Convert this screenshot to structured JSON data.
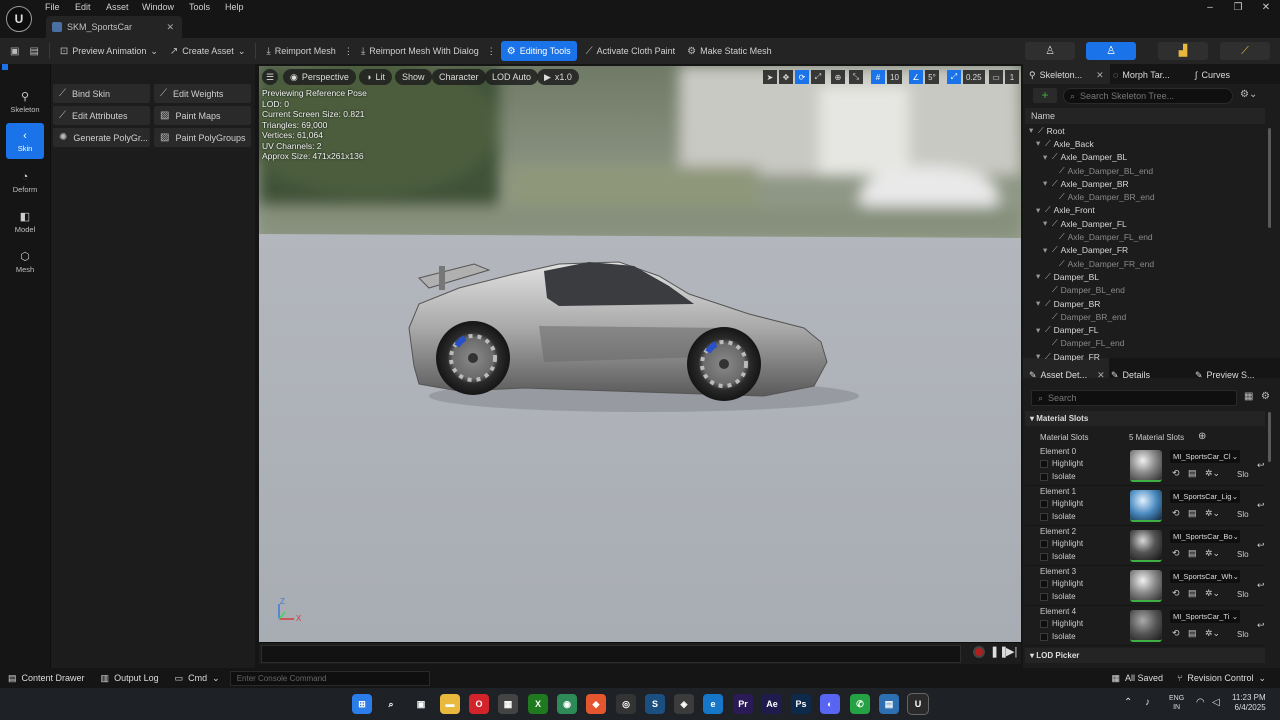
{
  "app": {
    "logo": "U",
    "menus": [
      "File",
      "Edit",
      "Asset",
      "Window",
      "Tools",
      "Help"
    ],
    "doc_tab": "SKM_SportsCar"
  },
  "window_controls": {
    "minimize": "–",
    "maximize": "❐",
    "close": "✕"
  },
  "toolbar": {
    "preview_animation": "Preview Animation",
    "create_asset": "Create Asset",
    "reimport_mesh": "Reimport Mesh",
    "reimport_with_dialog": "Reimport Mesh With Dialog",
    "editing_tools": "Editing Tools",
    "activate_cloth": "Activate Cloth Paint",
    "make_static": "Make Static Mesh"
  },
  "modes": [
    {
      "label": "Skeleton",
      "icon": "skeleton-icon"
    },
    {
      "label": "Skin",
      "icon": "skin-icon"
    },
    {
      "label": "Deform",
      "icon": "deform-icon"
    },
    {
      "label": "Model",
      "icon": "model-icon"
    },
    {
      "label": "Mesh",
      "icon": "mesh-icon"
    }
  ],
  "tools": [
    {
      "label": "Bind Skin",
      "icon": "bind-skin-icon"
    },
    {
      "label": "Edit Weights",
      "icon": "edit-weights-icon"
    },
    {
      "label": "Edit Attributes",
      "icon": "edit-attributes-icon"
    },
    {
      "label": "Paint Maps",
      "icon": "paint-maps-icon"
    },
    {
      "label": "Generate PolyGr...",
      "icon": "generate-polygroups-icon"
    },
    {
      "label": "Paint PolyGroups",
      "icon": "paint-polygroups-icon"
    }
  ],
  "viewport": {
    "perspective": "Perspective",
    "lit": "Lit",
    "show": "Show",
    "character": "Character",
    "lod": "LOD Auto",
    "speed": "x1.0",
    "grid_snap": "10",
    "angle_snap": "5°",
    "scale_snap": "0.25",
    "camera_speed": "1",
    "stats": [
      "Previewing Reference Pose",
      "LOD: 0",
      "Current Screen Size: 0.821",
      "Triangles: 69,000",
      "Vertices: 61,064",
      "UV Channels: 2",
      "Approx Size: 471x261x136"
    ],
    "axis_z": "Z",
    "axis_x": "X"
  },
  "skeleton_panel": {
    "tab_skeleton": "Skeleton...",
    "tab_morph": "Morph Tar...",
    "tab_curves": "Curves",
    "search_placeholder": "Search Skeleton Tree...",
    "column_name": "Name",
    "bones": [
      {
        "name": "Root",
        "dim": false
      },
      {
        "name": "Axle_Back",
        "dim": false
      },
      {
        "name": "Axle_Damper_BL",
        "dim": false
      },
      {
        "name": "Axle_Damper_BL_end",
        "dim": true
      },
      {
        "name": "Axle_Damper_BR",
        "dim": false
      },
      {
        "name": "Axle_Damper_BR_end",
        "dim": true
      },
      {
        "name": "Axle_Front",
        "dim": false
      },
      {
        "name": "Axle_Damper_FL",
        "dim": false
      },
      {
        "name": "Axle_Damper_FL_end",
        "dim": true
      },
      {
        "name": "Axle_Damper_FR",
        "dim": false
      },
      {
        "name": "Axle_Damper_FR_end",
        "dim": true
      },
      {
        "name": "Damper_BL",
        "dim": false
      },
      {
        "name": "Damper_BL_end",
        "dim": true
      },
      {
        "name": "Damper_BR",
        "dim": false
      },
      {
        "name": "Damper_BR_end",
        "dim": true
      },
      {
        "name": "Damper_FL",
        "dim": false
      },
      {
        "name": "Damper_FL_end",
        "dim": true
      },
      {
        "name": "Damper_FR",
        "dim": false
      }
    ]
  },
  "details_panel": {
    "tab_asset": "Asset Det...",
    "tab_details": "Details",
    "tab_preview": "Preview S...",
    "search_placeholder": "Search",
    "section_material_slots": "Material Slots",
    "material_slots_label": "Material Slots",
    "material_slots_count": "5 Material Slots",
    "highlight": "Highlight",
    "isolate": "Isolate",
    "slot_short": "Slo",
    "elements": [
      {
        "label": "Element 0",
        "material": "MI_SportsCar_Cl",
        "thumb": "chrome"
      },
      {
        "label": "Element 1",
        "material": "M_SportsCar_Lig",
        "thumb": "glass"
      },
      {
        "label": "Element 2",
        "material": "MI_SportsCar_Bo",
        "thumb": "dark"
      },
      {
        "label": "Element 3",
        "material": "M_SportsCar_Wh",
        "thumb": "chrome"
      },
      {
        "label": "Element 4",
        "material": "MI_SportsCar_Ti",
        "thumb": "tire"
      }
    ],
    "section_lod_picker": "LOD Picker"
  },
  "bottom_bar": {
    "content_drawer": "Content Drawer",
    "output_log": "Output Log",
    "cmd": "Cmd",
    "console_placeholder": "Enter Console Command",
    "all_saved": "All Saved",
    "revision_control": "Revision Control"
  },
  "taskbar": {
    "lang": "ENG",
    "region": "IN",
    "time": "11:23 PM",
    "date": "6/4/2025",
    "apps": [
      {
        "name": "start-icon",
        "color": "#2b7de9",
        "glyph": "⊞"
      },
      {
        "name": "search-icon",
        "color": "transparent",
        "glyph": "⌕"
      },
      {
        "name": "task-view-icon",
        "color": "transparent",
        "glyph": "▣"
      },
      {
        "name": "file-explorer-icon",
        "color": "#e8b93c",
        "glyph": "▬"
      },
      {
        "name": "opera-icon",
        "color": "#d3242c",
        "glyph": "O"
      },
      {
        "name": "store-icon",
        "color": "#444",
        "glyph": "▦"
      },
      {
        "name": "xbox-icon",
        "color": "#1f7a1f",
        "glyph": "X"
      },
      {
        "name": "chrome-icon",
        "color": "#2e8b57",
        "glyph": "◉"
      },
      {
        "name": "app-orange-icon",
        "color": "#e4572e",
        "glyph": "◆"
      },
      {
        "name": "blender-icon",
        "color": "#333",
        "glyph": "◎"
      },
      {
        "name": "steam-icon",
        "color": "#1b4f80",
        "glyph": "S"
      },
      {
        "name": "app-icon",
        "color": "#3b3b3b",
        "glyph": "◈"
      },
      {
        "name": "edge-icon",
        "color": "#1677c8",
        "glyph": "e"
      },
      {
        "name": "premiere-icon",
        "color": "#2a1a55",
        "glyph": "Pr"
      },
      {
        "name": "after-effects-icon",
        "color": "#1f1b4d",
        "glyph": "Ae"
      },
      {
        "name": "photoshop-icon",
        "color": "#0d2a4a",
        "glyph": "Ps"
      },
      {
        "name": "discord-icon",
        "color": "#5865f2",
        "glyph": "◐"
      },
      {
        "name": "whatsapp-icon",
        "color": "#25a244",
        "glyph": "✆"
      },
      {
        "name": "photos-icon",
        "color": "#2d6fb0",
        "glyph": "▤"
      },
      {
        "name": "unreal-icon",
        "color": "#2a2a2a",
        "glyph": "U"
      }
    ]
  }
}
